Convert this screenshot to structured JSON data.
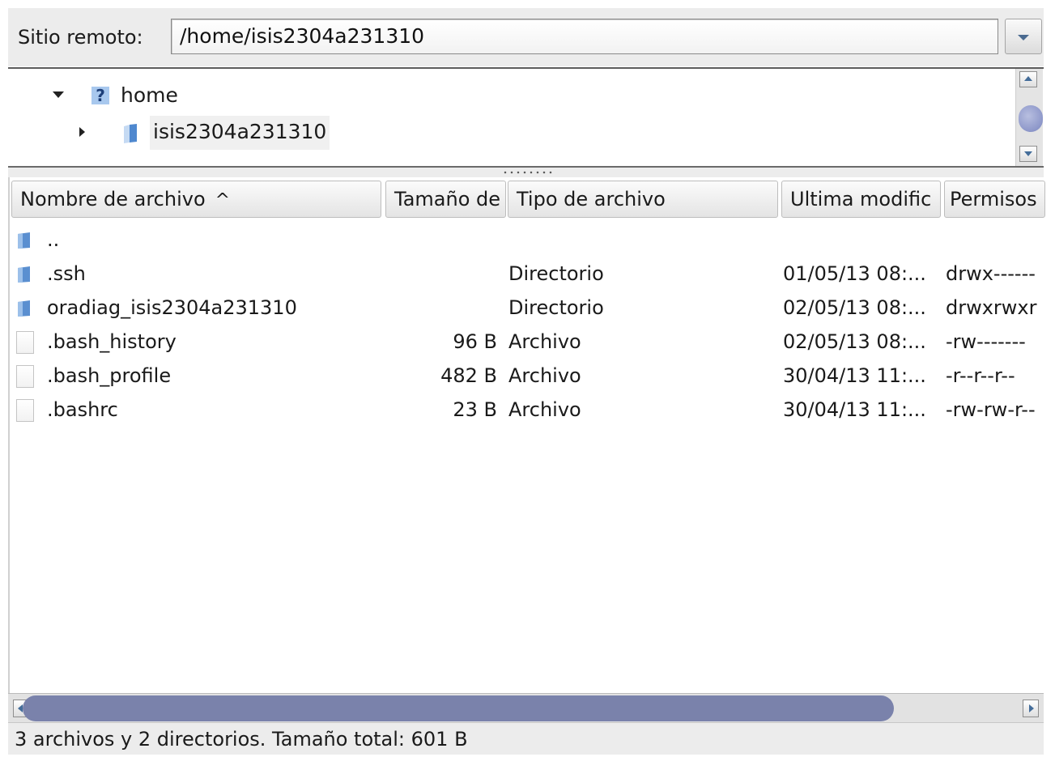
{
  "remote_site": {
    "label": "Sitio remoto:",
    "path": "/home/isis2304a231310"
  },
  "tree": {
    "items": [
      {
        "name": "home",
        "icon": "question-folder-icon",
        "state": "expanded"
      },
      {
        "name": "isis2304a231310",
        "icon": "folder-icon",
        "state": "collapsed"
      }
    ]
  },
  "columns": {
    "name": "Nombre de archivo",
    "name_sort_icon": "^",
    "size": "Tamaño de",
    "type": "Tipo de archivo",
    "modified": "Ultima modific",
    "permissions": "Permisos"
  },
  "files": [
    {
      "name": "..",
      "size": "",
      "type": "",
      "modified": "",
      "permissions": "",
      "icon": "folder-icon"
    },
    {
      "name": ".ssh",
      "size": "",
      "type": "Directorio",
      "modified": "01/05/13 08:...",
      "permissions": "drwx------",
      "icon": "folder-icon"
    },
    {
      "name": "oradiag_isis2304a231310",
      "size": "",
      "type": "Directorio",
      "modified": "02/05/13 08:...",
      "permissions": "drwxrwxr",
      "icon": "folder-icon"
    },
    {
      "name": ".bash_history",
      "size": "96 B",
      "type": "Archivo",
      "modified": "02/05/13 08:...",
      "permissions": "-rw-------",
      "icon": "file-icon"
    },
    {
      "name": ".bash_profile",
      "size": "482 B",
      "type": "Archivo",
      "modified": "30/04/13 11:...",
      "permissions": "-r--r--r--",
      "icon": "file-icon"
    },
    {
      "name": ".bashrc",
      "size": "23 B",
      "type": "Archivo",
      "modified": "30/04/13 11:...",
      "permissions": "-rw-rw-r--",
      "icon": "file-icon"
    }
  ],
  "status": "3 archivos y 2 directorios. Tamaño total: 601 B",
  "colors": {
    "accent": "#446d9a",
    "scroll_thumb": "#7a82ab",
    "folder": "#5a8fd0"
  }
}
